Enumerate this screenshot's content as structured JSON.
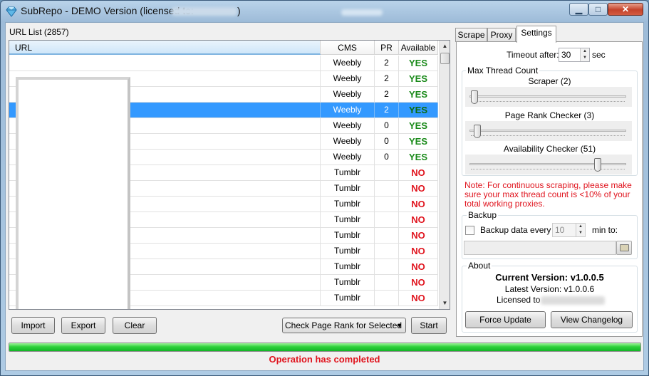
{
  "window": {
    "title": "SubRepo - DEMO Version (licensed to:",
    "title_close_paren": ")",
    "min_glyph": "▁",
    "max_glyph": "□",
    "close_glyph": "✕"
  },
  "url_list": {
    "label": "URL List (2857)",
    "columns": {
      "url": "URL",
      "cms": "CMS",
      "pr": "PR",
      "available": "Available"
    },
    "rows": [
      {
        "cms": "Weebly",
        "pr": "2",
        "available": "YES",
        "selected": false
      },
      {
        "cms": "Weebly",
        "pr": "2",
        "available": "YES",
        "selected": false
      },
      {
        "cms": "Weebly",
        "pr": "2",
        "available": "YES",
        "selected": false
      },
      {
        "cms": "Weebly",
        "pr": "2",
        "available": "YES",
        "selected": true
      },
      {
        "cms": "Weebly",
        "pr": "0",
        "available": "YES",
        "selected": false
      },
      {
        "cms": "Weebly",
        "pr": "0",
        "available": "YES",
        "selected": false
      },
      {
        "cms": "Weebly",
        "pr": "0",
        "available": "YES",
        "selected": false
      },
      {
        "cms": "Tumblr",
        "pr": "",
        "available": "NO",
        "selected": false
      },
      {
        "cms": "Tumblr",
        "pr": "",
        "available": "NO",
        "selected": false
      },
      {
        "cms": "Tumblr",
        "pr": "",
        "available": "NO",
        "selected": false
      },
      {
        "cms": "Tumblr",
        "pr": "",
        "available": "NO",
        "selected": false
      },
      {
        "cms": "Tumblr",
        "pr": "",
        "available": "NO",
        "selected": false
      },
      {
        "cms": "Tumblr",
        "pr": "",
        "available": "NO",
        "selected": false
      },
      {
        "cms": "Tumblr",
        "pr": "",
        "available": "NO",
        "selected": false
      },
      {
        "cms": "Tumblr",
        "pr": "",
        "available": "NO",
        "selected": false
      },
      {
        "cms": "Tumblr",
        "pr": "",
        "available": "NO",
        "selected": false
      }
    ]
  },
  "buttons": {
    "import": "Import",
    "export": "Export",
    "clear": "Clear",
    "start": "Start",
    "force_update": "Force Update",
    "view_changelog": "View Changelog"
  },
  "action_select": {
    "value": "Check Page Rank for Selected"
  },
  "tabs": [
    {
      "label": "Scrape",
      "active": false
    },
    {
      "label": "Proxy",
      "active": false
    },
    {
      "label": "Settings",
      "active": true
    }
  ],
  "settings": {
    "timeout_label": "Timeout after:",
    "timeout_value": "30",
    "timeout_unit": "sec",
    "max_thread_title": "Max Thread Count",
    "sliders": [
      {
        "label": "Scraper (2)",
        "value": 2
      },
      {
        "label": "Page Rank Checker (3)",
        "value": 3
      },
      {
        "label": "Availability Checker (51)",
        "value": 51
      }
    ],
    "note": "Note: For continuous scraping, please make sure your max thread count is <10% of your total working proxies.",
    "backup_title": "Backup",
    "backup_label": "Backup data every",
    "backup_value": "10",
    "backup_suffix": "min to:",
    "backup_checked": false
  },
  "about": {
    "title": "About",
    "current_version": "Current Version: v1.0.0.5",
    "latest_version": "Latest Version: v1.0.0.6",
    "licensed_to": "Licensed to"
  },
  "progress": {
    "value": 100
  },
  "status": "Operation has completed",
  "colors": {
    "yes": "#1a8a1a",
    "no": "#e0141e",
    "selection": "#3399ff",
    "progress": "#2fd13a"
  }
}
